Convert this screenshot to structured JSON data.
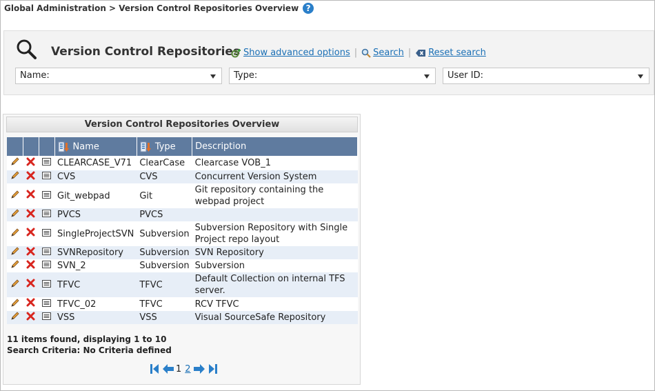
{
  "breadcrumb": "Global Administration > Version Control Repositories Overview",
  "help_label": "?",
  "search": {
    "title": "Version Control Repositories",
    "show_advanced": "Show advanced options",
    "search_label": "Search",
    "reset_label": "Reset search",
    "filters": {
      "name": "Name:",
      "type": "Type:",
      "user_id": "User ID:"
    }
  },
  "grid": {
    "title": "Version Control Repositories Overview",
    "columns": {
      "name": "Name",
      "type": "Type",
      "description": "Description"
    },
    "rows": [
      {
        "name": "CLEARCASE_V71",
        "type": "ClearCase",
        "description": "Clearcase VOB_1"
      },
      {
        "name": "CVS",
        "type": "CVS",
        "description": "Concurrent Version System"
      },
      {
        "name": "Git_webpad",
        "type": "Git",
        "description": "Git repository containing the webpad project"
      },
      {
        "name": "PVCS",
        "type": "PVCS",
        "description": ""
      },
      {
        "name": "SingleProjectSVN",
        "type": "Subversion",
        "description": "Subversion Repository with Single Project repo layout"
      },
      {
        "name": "SVNRepository",
        "type": "Subversion",
        "description": "SVN Repository"
      },
      {
        "name": "SVN_2",
        "type": "Subversion",
        "description": "Subversion"
      },
      {
        "name": "TFVC",
        "type": "TFVC",
        "description": "Default Collection on internal TFS server."
      },
      {
        "name": "TFVC_02",
        "type": "TFVC",
        "description": "RCV TFVC"
      },
      {
        "name": "VSS",
        "type": "VSS",
        "description": "Visual SourceSafe Repository"
      }
    ],
    "summary": "11 items found, displaying 1 to 10",
    "criteria": "Search Criteria: No Criteria defined",
    "pager": {
      "current": "1",
      "next_page": "2"
    }
  },
  "colors": {
    "header": "#5f7b9f",
    "link": "#1a6fb5",
    "row_alt": "#e7eef7"
  }
}
